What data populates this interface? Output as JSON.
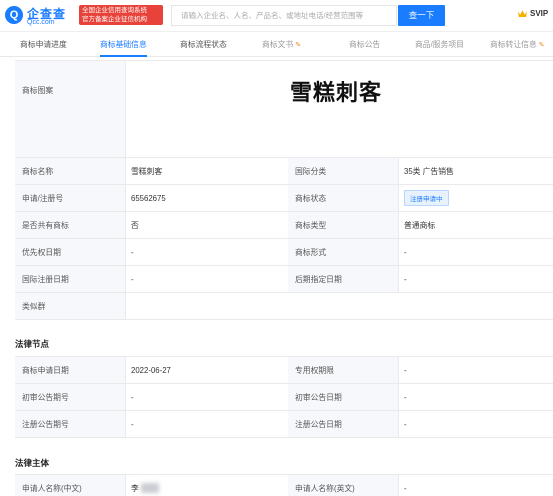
{
  "header": {
    "logo_mark": "Q",
    "logo_cn": "企查查",
    "logo_en": "Qcc.com",
    "badge_line1": "全国企业信用查询系统",
    "badge_line2": "官方备案企业征信机构",
    "search_placeholder": "请输入企业名、人名、产品名、或地址电话/经营范围等",
    "search_button": "查一下",
    "svip_label": "SVIP"
  },
  "tabs": [
    {
      "label": "商标申请进度",
      "active": false,
      "dim": false,
      "pen": false
    },
    {
      "label": "商标基础信息",
      "active": true,
      "dim": false,
      "pen": false
    },
    {
      "label": "商标流程状态",
      "active": false,
      "dim": false,
      "pen": false
    },
    {
      "label": "商标文书",
      "active": false,
      "dim": true,
      "pen": true
    },
    {
      "label": "商标公告",
      "active": false,
      "dim": true,
      "pen": false
    },
    {
      "label": "商品/服务项目",
      "active": false,
      "dim": true,
      "pen": false
    },
    {
      "label": "商标转让信息",
      "active": false,
      "dim": true,
      "pen": true
    }
  ],
  "basic": {
    "image_label": "商标图案",
    "trademark_text": "雪糕刺客",
    "rows": [
      {
        "l1": "商标名称",
        "v1": "雪糕刺客",
        "l2": "国际分类",
        "v2": "35类 广告销售"
      },
      {
        "l1": "申请/注册号",
        "v1": "65562675",
        "l2": "商标状态",
        "v2": "注册申请中"
      },
      {
        "l1": "是否共有商标",
        "v1": "否",
        "l2": "商标类型",
        "v2": "普通商标"
      },
      {
        "l1": "优先权日期",
        "v1": "-",
        "l2": "商标形式",
        "v2": "-"
      },
      {
        "l1": "国际注册日期",
        "v1": "-",
        "l2": "后期指定日期",
        "v2": "-"
      }
    ],
    "similar_label": "类似群"
  },
  "legal_nodes": {
    "title": "法律节点",
    "rows": [
      {
        "l1": "商标申请日期",
        "v1": "2022-06-27",
        "l2": "专用权期限",
        "v2": "-"
      },
      {
        "l1": "初审公告期号",
        "v1": "-",
        "l2": "初审公告日期",
        "v2": "-"
      },
      {
        "l1": "注册公告期号",
        "v1": "-",
        "l2": "注册公告日期",
        "v2": "-"
      }
    ]
  },
  "legal_subject": {
    "title": "法律主体",
    "rows": [
      {
        "l1": "申请人名称(中文)",
        "v1": "李",
        "l2": "申请人名称(英文)",
        "v2": "-"
      }
    ]
  },
  "colors": {
    "accent": "#1a7cff",
    "badge_red": "#e8433a",
    "label_bg": "#f6f8fb",
    "vip_gold": "#f5b000"
  }
}
